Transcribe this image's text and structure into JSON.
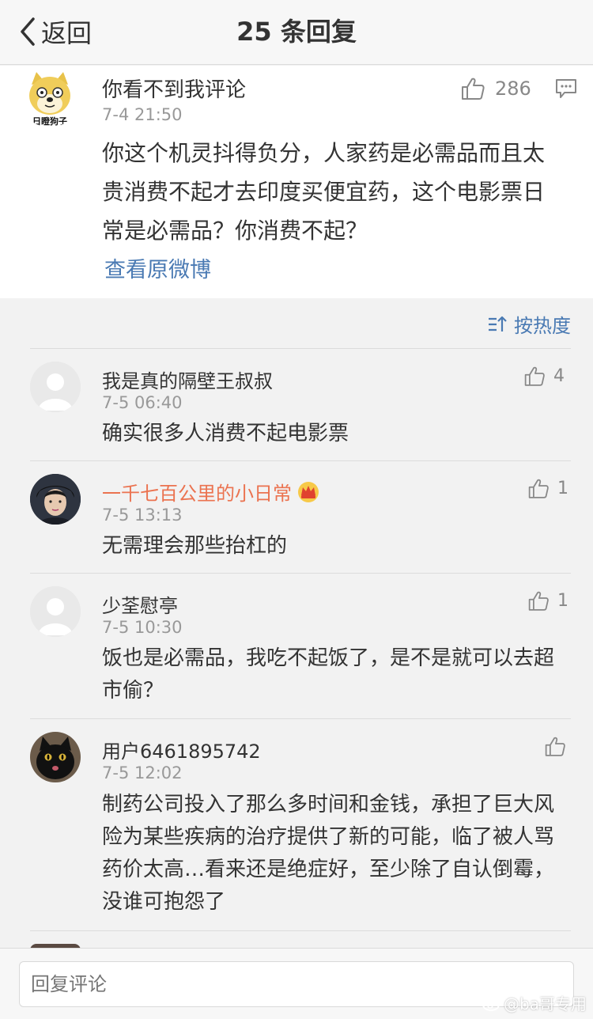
{
  "nav": {
    "back_label": "返回",
    "title": "25 条回复"
  },
  "main_comment": {
    "user": "你看不到我评论",
    "time": "7-4 21:50",
    "likes": "286",
    "text": "你这个机灵抖得负分，人家药是必需品而且太贵消费不起才去印度买便宜药，这个电影票日常是必需品？你消费不起？",
    "avatar_caption": "日瞪狗子",
    "view_original": "查看原微博"
  },
  "sort_label": "按热度",
  "replies": [
    {
      "user": "我是真的隔壁王叔叔",
      "time": "7-5 06:40",
      "likes": "4",
      "text": "确实很多人消费不起电影票",
      "verified": false
    },
    {
      "user": "一千七百公里的小日常",
      "time": "7-5 13:13",
      "likes": "1",
      "text": "无需理会那些抬杠的",
      "verified": true
    },
    {
      "user": "少荃慰亭",
      "time": "7-5 10:30",
      "likes": "1",
      "text": "饭也是必需品，我吃不起饭了，是不是就可以去超市偷？",
      "verified": false
    },
    {
      "user": "用户6461895742",
      "time": "7-5 12:02",
      "likes": "",
      "text": "制药公司投入了那么多时间和金钱，承担了巨大风险为某些疾病的治疗提供了新的可能，临了被人骂药价太高…看来还是绝症好，至少除了自认倒霉，没谁可抱怨了",
      "verified": false
    }
  ],
  "bottom": {
    "reply_placeholder": "回复评论",
    "watermark": "@ba哥专用"
  },
  "colors": {
    "link": "#4a7ab3",
    "vip_name": "#eb7350",
    "meta": "#999999"
  }
}
